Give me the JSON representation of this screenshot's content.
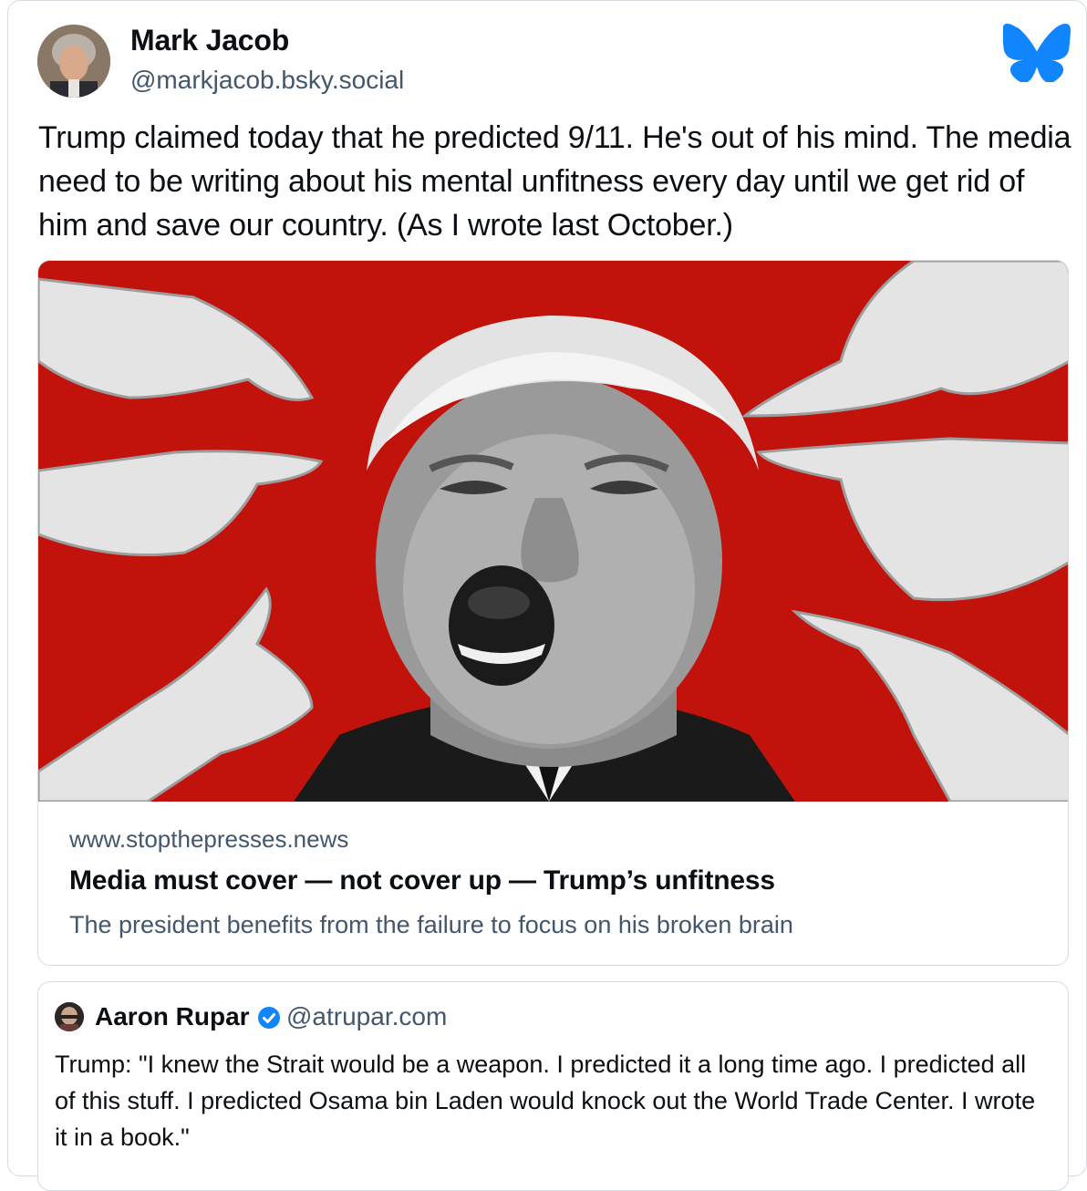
{
  "post": {
    "author": {
      "name": "Mark Jacob",
      "handle": "@markjacob.bsky.social"
    },
    "platform_icon": "bluesky-butterfly-icon",
    "text": "Trump claimed today that he predicted 9/11. He's out of his mind. The media need to be writing about his mental unfitness every day until we get rid of him and save our country. (As I wrote last October.)"
  },
  "link_card": {
    "domain": "www.stopthepresses.news",
    "title": "Media must cover — not cover up — Trump’s unfitness",
    "description": "The president benefits from the failure to focus on his broken brain"
  },
  "quote": {
    "author": {
      "name": "Aaron Rupar",
      "handle": "@atrupar.com",
      "verified": true
    },
    "text": "Trump: \"I knew the Strait would be a weapon. I predicted it a long time ago. I predicted all of this stuff. I predicted Osama bin Laden would knock out the World Trade Center. I wrote it in a book.\""
  },
  "colors": {
    "accent": "#1185fe",
    "image_background": "#c2120c",
    "muted_text": "#42576c",
    "border": "#d4dbe2"
  }
}
